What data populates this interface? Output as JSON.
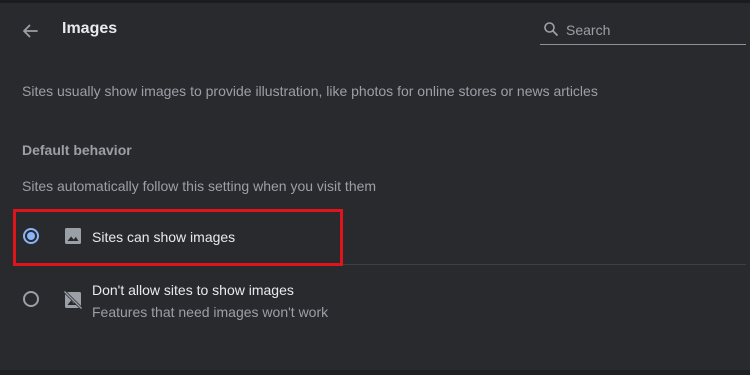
{
  "header": {
    "title": "Images",
    "back_icon": "arrow-left-icon"
  },
  "search": {
    "placeholder": "Search",
    "value": "",
    "icon": "search-icon"
  },
  "main": {
    "description": "Sites usually show images to provide illustration, like photos for online stores or news articles",
    "default_behavior": {
      "title": "Default behavior",
      "subtitle": "Sites automatically follow this setting when you visit them",
      "options": [
        {
          "label": "Sites can show images",
          "sublabel": "",
          "icon": "image-icon",
          "selected": true
        },
        {
          "label": "Don't allow sites to show images",
          "sublabel": "Features that need images won't work",
          "icon": "image-off-icon",
          "selected": false
        }
      ]
    }
  },
  "colors": {
    "background": "#292a2d",
    "text_primary": "#e8eaed",
    "text_secondary": "#9aa0a6",
    "accent": "#8ab4f8",
    "highlight_box": "#e0151c"
  }
}
